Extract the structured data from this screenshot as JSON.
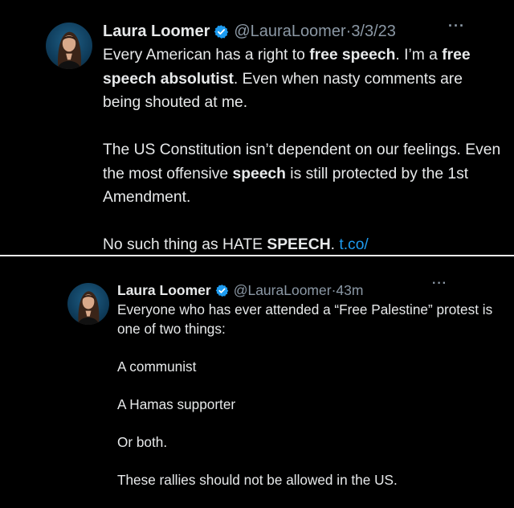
{
  "tweets": [
    {
      "author_name": "Laura Loomer",
      "handle": "@LauraLoomer",
      "separator": "·",
      "time": "3/3/23",
      "more_label": "···",
      "avatar_icon": "profile-photo",
      "verified_icon": "verified-badge-icon",
      "paragraphs": [
        [
          {
            "text": "Every American has a right to "
          },
          {
            "text": "free speech",
            "bold": true
          },
          {
            "text": ". I’m a "
          },
          {
            "text": "free speech absolutist",
            "bold": true
          },
          {
            "text": ". Even when nasty comments are being shouted at me."
          }
        ],
        [
          {
            "text": "The US Constitution isn’t dependent on our feelings. Even the most offensive "
          },
          {
            "text": "speech",
            "bold": true
          },
          {
            "text": " is still protected by the 1st Amendment."
          }
        ],
        [
          {
            "text": "No such thing as HATE "
          },
          {
            "text": "SPEECH",
            "bold": true
          },
          {
            "text": ". "
          },
          {
            "text": "t.co/",
            "link": true
          }
        ]
      ]
    },
    {
      "author_name": "Laura Loomer",
      "handle": "@LauraLoomer",
      "separator": "·",
      "time": "43m",
      "more_label": "···",
      "avatar_icon": "profile-photo",
      "verified_icon": "verified-badge-icon",
      "paragraphs": [
        [
          {
            "text": "Everyone who has ever attended a “Free Palestine” protest is one of two things:"
          }
        ],
        [
          {
            "text": "A communist"
          }
        ],
        [
          {
            "text": "A Hamas supporter"
          }
        ],
        [
          {
            "text": "Or both."
          }
        ],
        [
          {
            "text": "These rallies should not be allowed in the US."
          }
        ]
      ]
    }
  ],
  "colors": {
    "background": "#000000",
    "text": "#e7e9ea",
    "secondary_text": "#8b98a5",
    "link": "#1d9bf0",
    "verified": "#1d9bf0",
    "divider": "#f2f2f2"
  }
}
